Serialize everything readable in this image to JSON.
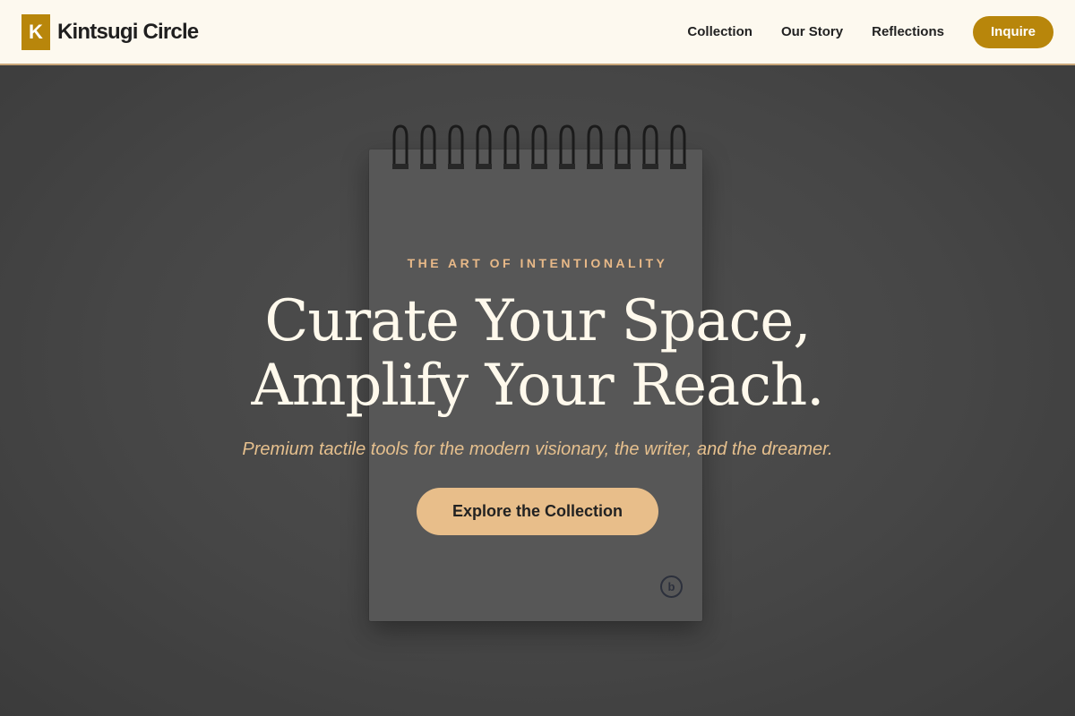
{
  "nav": {
    "logo_letter": "K",
    "brand_name": "Kintsugi Circle",
    "links": [
      "Collection",
      "Our Story",
      "Reflections"
    ],
    "cta_label": "Inquire"
  },
  "hero": {
    "eyebrow": "THE ART OF INTENTIONALITY",
    "headline_line1": "Curate Your Space,",
    "headline_line2": "Amplify Your Reach.",
    "subline": "Premium tactile tools for the modern visionary, the writer, and the dreamer.",
    "cta_label": "Explore the Collection",
    "notepad_mark": "b"
  },
  "colors": {
    "accent": "#b8860b",
    "nav_background": "#fdf9ef",
    "cta_background": "#e8be8a",
    "eyebrow": "#e8b988",
    "headline": "#fff9ec"
  }
}
